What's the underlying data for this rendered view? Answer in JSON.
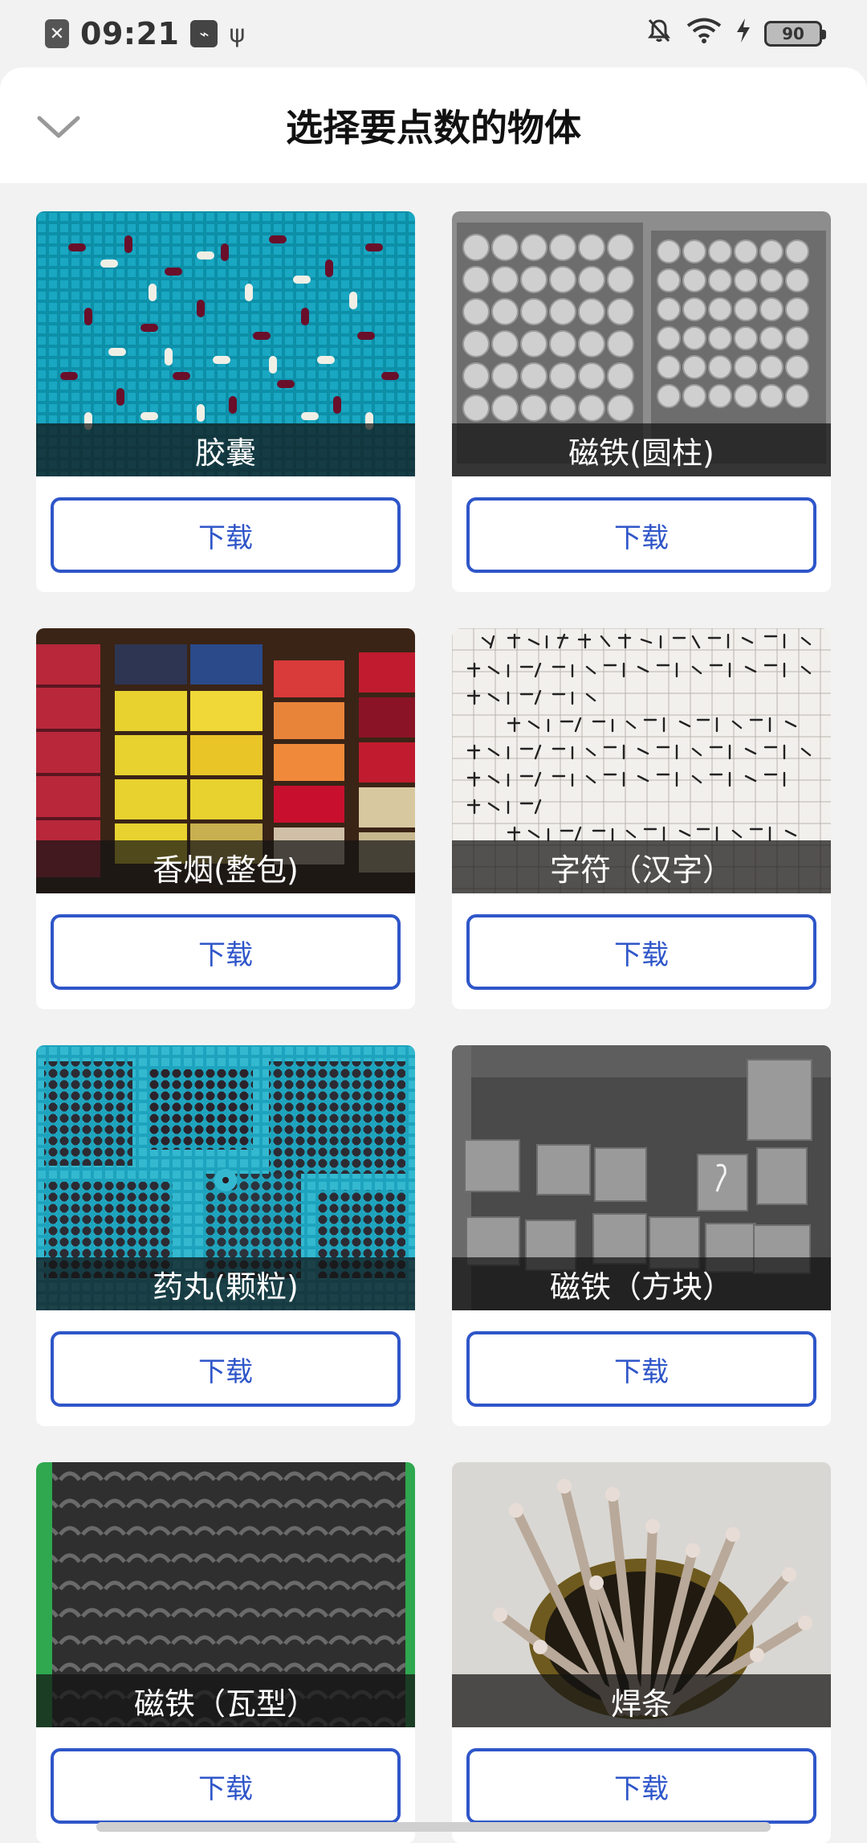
{
  "status_bar": {
    "time": "09:21",
    "battery": "90",
    "icons": [
      "notification-x-icon",
      "app-square-icon",
      "usb-icon",
      "mute-bell-icon",
      "wifi-icon",
      "charging-bolt-icon",
      "battery-icon"
    ]
  },
  "header": {
    "title": "选择要点数的物体",
    "back_icon": "chevron-down-icon"
  },
  "items": [
    {
      "label": "胶囊",
      "button": "下载",
      "image": "capsules-on-blue-tray"
    },
    {
      "label": "磁铁(圆柱)",
      "button": "下载",
      "image": "cylindrical-magnets-in-trays"
    },
    {
      "label": "香烟(整包)",
      "button": "下载",
      "image": "cigarette-packs-on-shelf"
    },
    {
      "label": "字符（汉字）",
      "button": "下载",
      "image": "handwritten-chinese-text"
    },
    {
      "label": "药丸(颗粒)",
      "button": "下载",
      "image": "pills-on-blue-tray"
    },
    {
      "label": "磁铁（方块）",
      "button": "下载",
      "image": "block-magnets-in-box"
    },
    {
      "label": "磁铁（瓦型）",
      "button": "下载",
      "image": "arc-magnets-on-green"
    },
    {
      "label": "焊条",
      "button": "下载",
      "image": "welding-rods-in-can"
    }
  ],
  "colors": {
    "accent": "#2f56c9",
    "background": "#f2f2f2",
    "card": "#ffffff"
  }
}
